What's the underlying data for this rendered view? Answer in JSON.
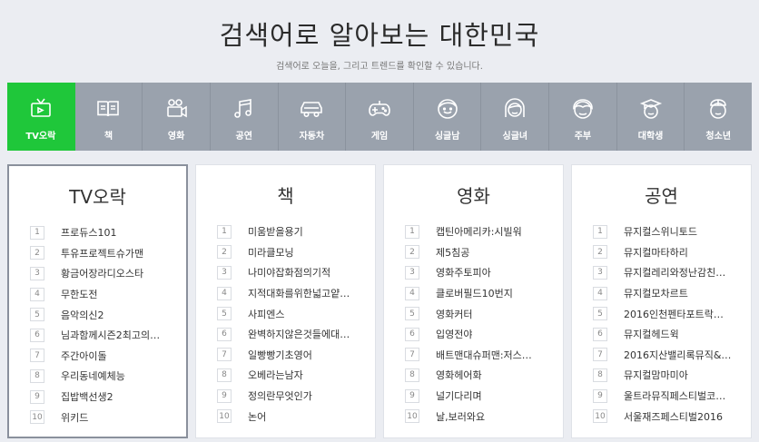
{
  "header": {
    "title": "검색어로 알아보는 대한민국",
    "subtitle": "검색어로 오늘을, 그리고 트렌드를 확인할 수 있습니다."
  },
  "categories": [
    {
      "label": "TV오락",
      "icon": "tv-icon",
      "active": true
    },
    {
      "label": "책",
      "icon": "book-icon"
    },
    {
      "label": "영화",
      "icon": "movie-camera-icon"
    },
    {
      "label": "공연",
      "icon": "music-note-icon"
    },
    {
      "label": "자동차",
      "icon": "car-icon"
    },
    {
      "label": "게임",
      "icon": "gamepad-icon"
    },
    {
      "label": "싱글남",
      "icon": "single-man-icon"
    },
    {
      "label": "싱글녀",
      "icon": "single-woman-icon"
    },
    {
      "label": "주부",
      "icon": "housewife-icon"
    },
    {
      "label": "대학생",
      "icon": "college-student-icon"
    },
    {
      "label": "청소년",
      "icon": "teenager-icon"
    }
  ],
  "cards": [
    {
      "title": "TV오락",
      "items": [
        {
          "rank": "1",
          "text": "프로듀스101"
        },
        {
          "rank": "2",
          "text": "투유프로젝트슈가맨"
        },
        {
          "rank": "3",
          "text": "황금어장라디오스타"
        },
        {
          "rank": "4",
          "text": "무한도전"
        },
        {
          "rank": "5",
          "text": "음악의신2"
        },
        {
          "rank": "6",
          "text": "님과함께시즌2최고의…"
        },
        {
          "rank": "7",
          "text": "주간아이돌"
        },
        {
          "rank": "8",
          "text": "우리동네예체능"
        },
        {
          "rank": "9",
          "text": "집밥백선생2"
        },
        {
          "rank": "10",
          "text": "위키드"
        }
      ]
    },
    {
      "title": "책",
      "items": [
        {
          "rank": "1",
          "text": "미움받을용기"
        },
        {
          "rank": "2",
          "text": "미라클모닝"
        },
        {
          "rank": "3",
          "text": "나미야잡화점의기적"
        },
        {
          "rank": "4",
          "text": "지적대화를위한넓고얕…"
        },
        {
          "rank": "5",
          "text": "사피엔스"
        },
        {
          "rank": "6",
          "text": "완벽하지않은것들에대…"
        },
        {
          "rank": "7",
          "text": "일빵빵기초영어"
        },
        {
          "rank": "8",
          "text": "오베라는남자"
        },
        {
          "rank": "9",
          "text": "정의란무엇인가"
        },
        {
          "rank": "10",
          "text": "논어"
        }
      ]
    },
    {
      "title": "영화",
      "items": [
        {
          "rank": "1",
          "text": "캡틴아메리카:시빌워"
        },
        {
          "rank": "2",
          "text": "제5침공"
        },
        {
          "rank": "3",
          "text": "영화주토피아"
        },
        {
          "rank": "4",
          "text": "클로버필드10번지"
        },
        {
          "rank": "5",
          "text": "영화커터"
        },
        {
          "rank": "6",
          "text": "입영전야"
        },
        {
          "rank": "7",
          "text": "배트맨대슈퍼맨:저스…"
        },
        {
          "rank": "8",
          "text": "영화헤어화"
        },
        {
          "rank": "9",
          "text": "널기다리며"
        },
        {
          "rank": "10",
          "text": "날,보러와요"
        }
      ]
    },
    {
      "title": "공연",
      "items": [
        {
          "rank": "1",
          "text": "뮤지컬스위니토드"
        },
        {
          "rank": "2",
          "text": "뮤지컬마타하리"
        },
        {
          "rank": "3",
          "text": "뮤지컬레리와정난감친…"
        },
        {
          "rank": "4",
          "text": "뮤지컬모차르트"
        },
        {
          "rank": "5",
          "text": "2016인천펜타포트락…"
        },
        {
          "rank": "6",
          "text": "뮤지컬헤드윅"
        },
        {
          "rank": "7",
          "text": "2016지산밸리록뮤직&…"
        },
        {
          "rank": "8",
          "text": "뮤지컬맘마미아"
        },
        {
          "rank": "9",
          "text": "울트라뮤직페스티벌코…"
        },
        {
          "rank": "10",
          "text": "서울재즈페스티벌2016"
        }
      ]
    }
  ],
  "colors": {
    "active": "#1fc73a",
    "category_bar": "#9aa2ad",
    "background": "#ebedf2"
  }
}
